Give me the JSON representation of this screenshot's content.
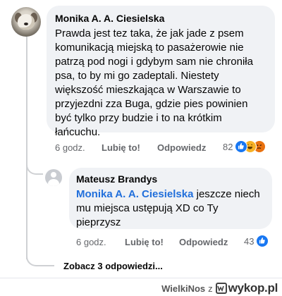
{
  "comment": {
    "author": "Monika A. A. Ciesielska",
    "text": "Prawda jest tez taka, że jak jade z psem komunikacją miejską to pasażerowie nie patrzą pod nogi i gdybym sam nie chroniła psa, to by mi go zadeptali. Niestety większość mieszkająca w Warszawie to przyjezdni zza Buga, gdzie pies powinien być tylko przy budzie i to na krótkim łańcuchu.",
    "time": "6 godz.",
    "like_label": "Lubię to!",
    "reply_label": "Odpowiedz",
    "reaction_count": "82",
    "reactions": [
      "like-reaction-icon",
      "haha-reaction-icon",
      "angry-reaction-icon"
    ]
  },
  "reply": {
    "author": "Mateusz Brandys",
    "mention": "Monika A. A. Ciesielska",
    "text": "jeszcze niech mu miejsca ustępują XD co Ty pieprzysz",
    "time": "6 godz.",
    "like_label": "Lubię to!",
    "reply_label": "Odpowiedz",
    "reaction_count": "43",
    "reactions": [
      "like-reaction-icon"
    ]
  },
  "more_replies": "Zobacz 3 odpowiedzi...",
  "watermark": {
    "user": "WielkiNos",
    "joiner": "z",
    "site": "wykop.pl"
  },
  "colors": {
    "bubble": "#f0f2f5",
    "mention": "#216fdb",
    "like": "#1877f2",
    "haha": "#f7b125",
    "angry": "#e9710f",
    "meta_text": "#65676b"
  }
}
